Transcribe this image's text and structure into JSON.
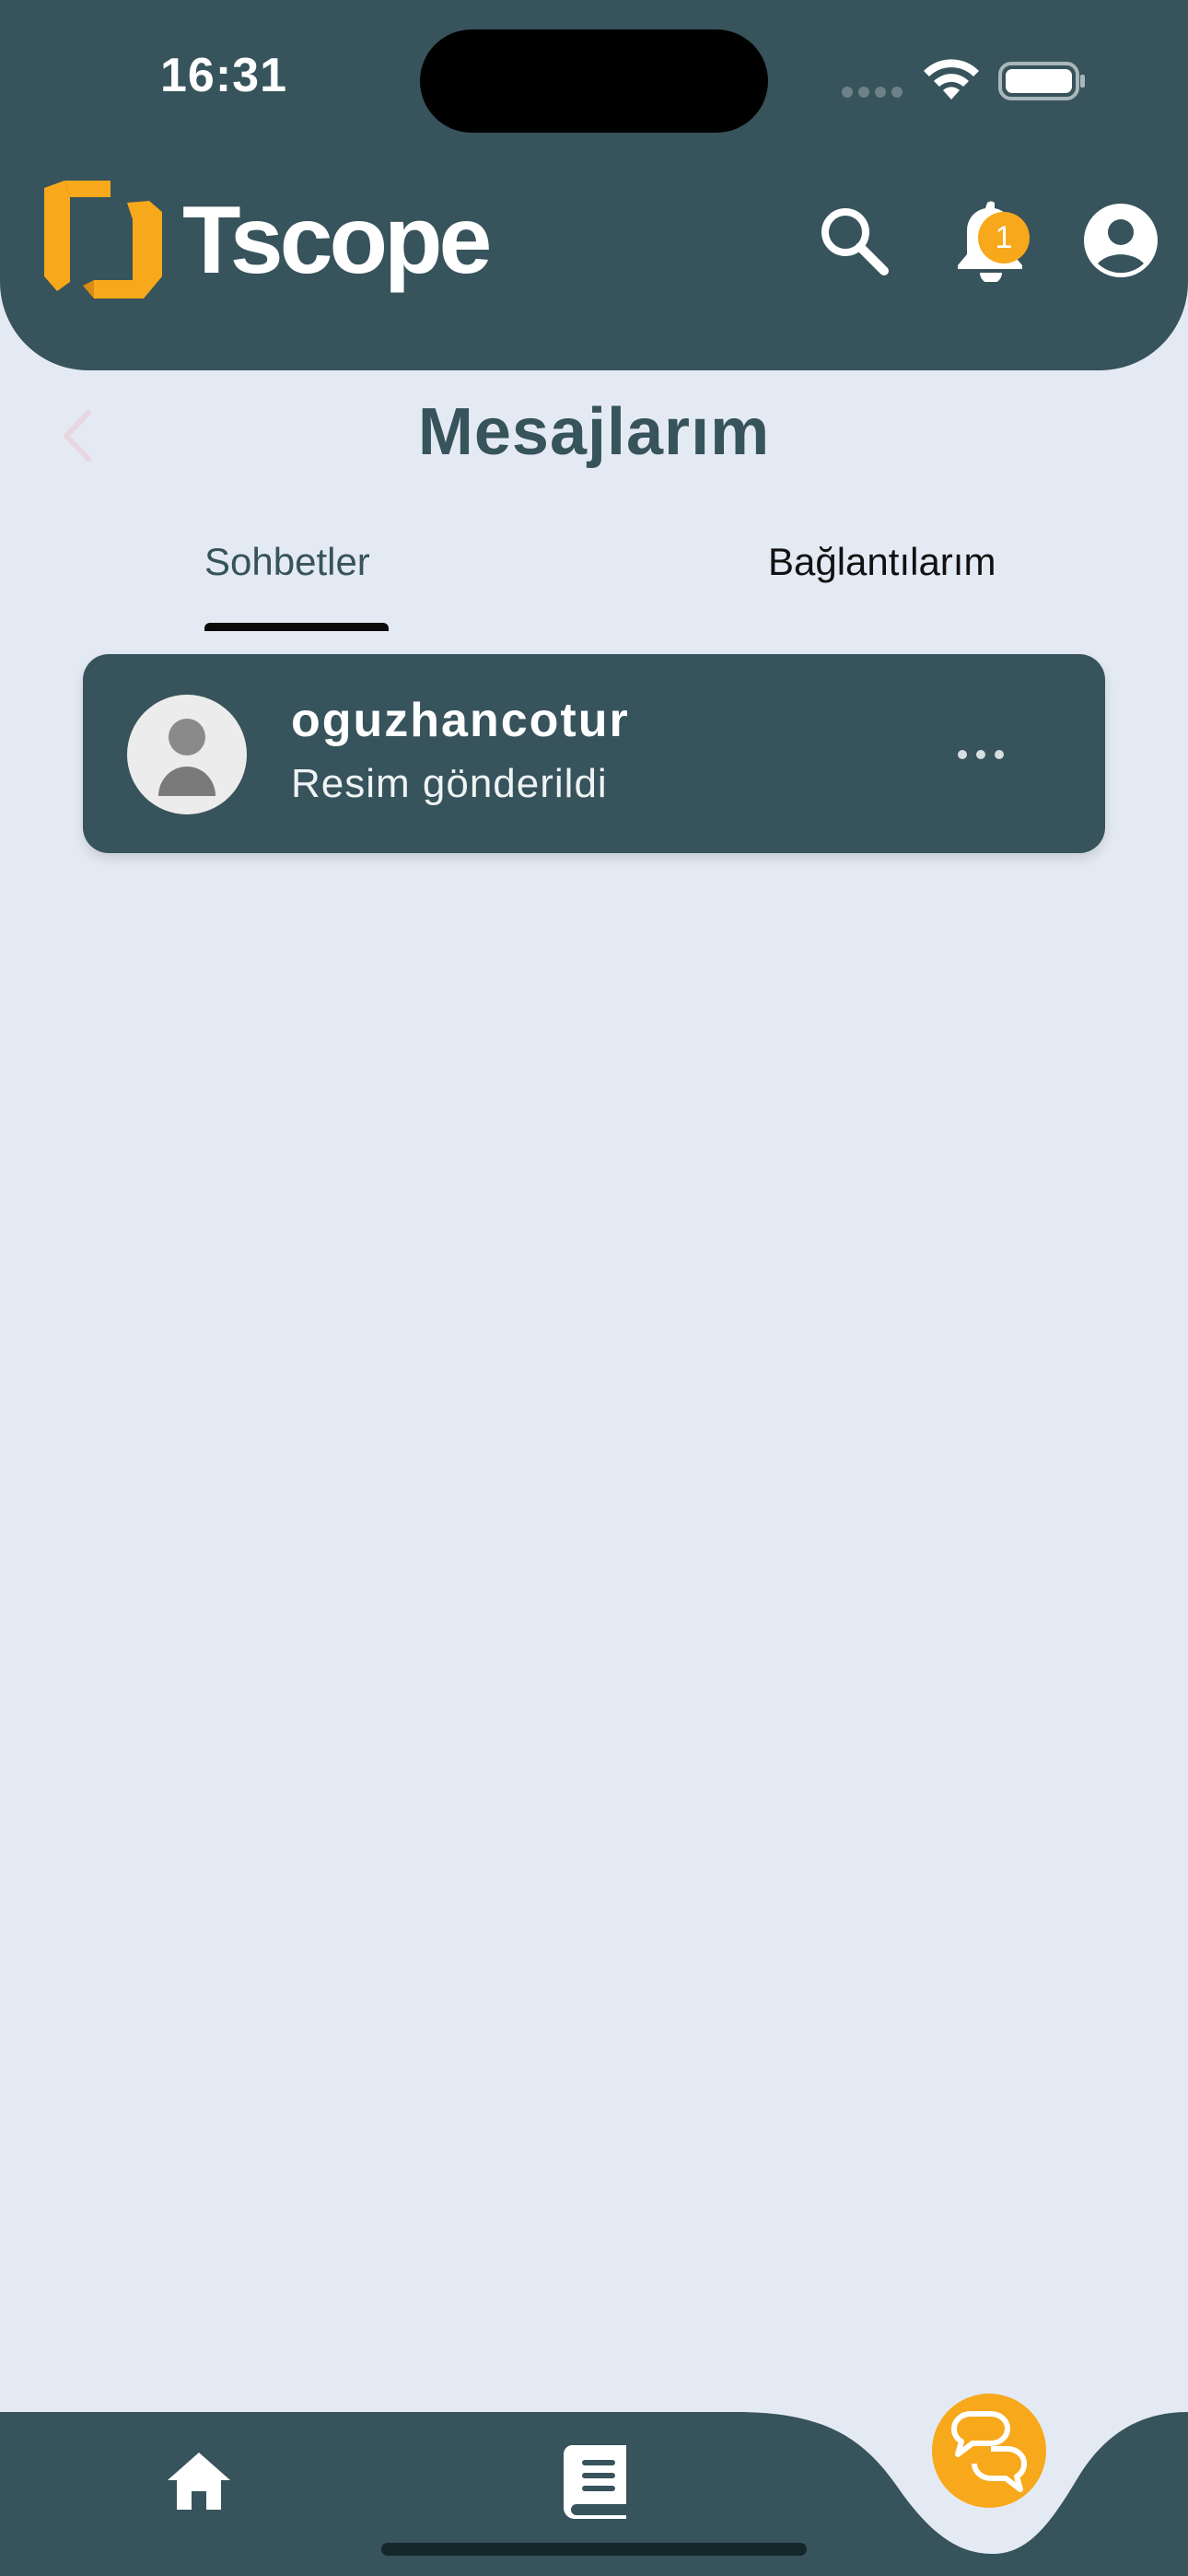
{
  "status_bar": {
    "time": "16:31"
  },
  "header": {
    "brand": "Tscope",
    "notification_count": "1",
    "colors": {
      "header_bg": "#37535b",
      "accent": "#f7a81b"
    },
    "icons": [
      "search-icon",
      "bell-icon",
      "account-icon"
    ]
  },
  "page": {
    "title": "Mesajlarım",
    "back_icon": "chevron-left-icon"
  },
  "tabs": [
    {
      "label": "Sohbetler",
      "active": true
    },
    {
      "label": "Bağlantılarım",
      "active": false
    }
  ],
  "chats": [
    {
      "name": "oguzhancotur",
      "last_message": "Resim gönderildi",
      "avatar": "default-user-icon",
      "menu_icon": "more-horizontal-icon"
    }
  ],
  "bottom_nav": {
    "items": [
      "home-icon",
      "book-icon",
      "chat-bubbles-icon"
    ]
  }
}
